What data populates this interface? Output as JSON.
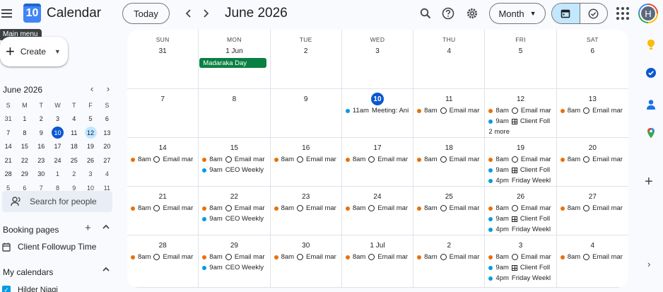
{
  "header": {
    "tooltip": "Main menu",
    "logo_day": "10",
    "app_title": "Calendar",
    "today_label": "Today",
    "prev_icon": "chevron-left-icon",
    "next_icon": "chevron-right-icon",
    "current_period": "June 2026",
    "view_label": "Month",
    "avatar_initial": "H"
  },
  "sidebar": {
    "create_label": "Create",
    "mini_calendar": {
      "title": "June 2026",
      "weekday_heads": [
        "S",
        "M",
        "T",
        "W",
        "T",
        "F",
        "S"
      ],
      "weeks": [
        [
          "31",
          "1",
          "2",
          "3",
          "4",
          "5",
          "6"
        ],
        [
          "7",
          "8",
          "9",
          "10",
          "11",
          "12",
          "13"
        ],
        [
          "14",
          "15",
          "16",
          "17",
          "18",
          "19",
          "20"
        ],
        [
          "21",
          "22",
          "23",
          "24",
          "25",
          "26",
          "27"
        ],
        [
          "28",
          "29",
          "30",
          "1",
          "2",
          "3",
          "4"
        ],
        [
          "5",
          "6",
          "7",
          "8",
          "9",
          "10",
          "11"
        ]
      ],
      "today": "10",
      "selected": "12"
    },
    "search_people_placeholder": "Search for people",
    "booking_pages_title": "Booking pages",
    "booking_item": "Client Followup Time",
    "my_calendars_title": "My calendars",
    "my_calendar_item": "Hilder Njagi"
  },
  "colors": {
    "accent": "#0b57d0",
    "holiday": "#0b8043",
    "orange": "#e8710a",
    "blue": "#039be5"
  },
  "month_grid": {
    "weekday_heads": [
      "SUN",
      "MON",
      "TUE",
      "WED",
      "THU",
      "FRI",
      "SAT"
    ],
    "weeks": [
      [
        {
          "label": "31",
          "events": []
        },
        {
          "label": "1 Jun",
          "allday": "Madaraka Day",
          "events": []
        },
        {
          "label": "2",
          "events": []
        },
        {
          "label": "3",
          "events": []
        },
        {
          "label": "4",
          "events": []
        },
        {
          "label": "5",
          "events": []
        },
        {
          "label": "6",
          "events": []
        }
      ],
      [
        {
          "label": "7",
          "events": []
        },
        {
          "label": "8",
          "events": []
        },
        {
          "label": "9",
          "events": []
        },
        {
          "label": "10",
          "today": true,
          "events": [
            {
              "color": "blue",
              "time": "11am",
              "kind": "none",
              "title": "Meeting: Ani"
            }
          ]
        },
        {
          "label": "11",
          "events": [
            {
              "color": "orange",
              "time": "8am",
              "kind": "task",
              "title": "Email mar"
            }
          ]
        },
        {
          "label": "12",
          "events": [
            {
              "color": "orange",
              "time": "8am",
              "kind": "task",
              "title": "Email mar"
            },
            {
              "color": "blue",
              "time": "9am",
              "kind": "booking",
              "title": "Client Foll"
            }
          ],
          "more": "2 more"
        },
        {
          "label": "13",
          "events": [
            {
              "color": "orange",
              "time": "8am",
              "kind": "task",
              "title": "Email mar"
            }
          ]
        }
      ],
      [
        {
          "label": "14",
          "events": [
            {
              "color": "orange",
              "time": "8am",
              "kind": "task",
              "title": "Email mar"
            }
          ]
        },
        {
          "label": "15",
          "events": [
            {
              "color": "orange",
              "time": "8am",
              "kind": "task",
              "title": "Email mar"
            },
            {
              "color": "blue",
              "time": "9am",
              "kind": "none",
              "title": "CEO Weekly"
            }
          ]
        },
        {
          "label": "16",
          "events": [
            {
              "color": "orange",
              "time": "8am",
              "kind": "task",
              "title": "Email mar"
            }
          ]
        },
        {
          "label": "17",
          "events": [
            {
              "color": "orange",
              "time": "8am",
              "kind": "task",
              "title": "Email mar"
            }
          ]
        },
        {
          "label": "18",
          "events": [
            {
              "color": "orange",
              "time": "8am",
              "kind": "task",
              "title": "Email mar"
            }
          ]
        },
        {
          "label": "19",
          "events": [
            {
              "color": "orange",
              "time": "8am",
              "kind": "task",
              "title": "Email mar"
            },
            {
              "color": "blue",
              "time": "9am",
              "kind": "booking",
              "title": "Client Foll"
            },
            {
              "color": "blue",
              "time": "4pm",
              "kind": "none",
              "title": "Friday Weekl"
            }
          ]
        },
        {
          "label": "20",
          "events": [
            {
              "color": "orange",
              "time": "8am",
              "kind": "task",
              "title": "Email mar"
            }
          ]
        }
      ],
      [
        {
          "label": "21",
          "events": [
            {
              "color": "orange",
              "time": "8am",
              "kind": "task",
              "title": "Email mar"
            }
          ]
        },
        {
          "label": "22",
          "events": [
            {
              "color": "orange",
              "time": "8am",
              "kind": "task",
              "title": "Email mar"
            },
            {
              "color": "blue",
              "time": "9am",
              "kind": "none",
              "title": "CEO Weekly"
            }
          ]
        },
        {
          "label": "23",
          "events": [
            {
              "color": "orange",
              "time": "8am",
              "kind": "task",
              "title": "Email mar"
            }
          ]
        },
        {
          "label": "24",
          "events": [
            {
              "color": "orange",
              "time": "8am",
              "kind": "task",
              "title": "Email mar"
            }
          ]
        },
        {
          "label": "25",
          "events": [
            {
              "color": "orange",
              "time": "8am",
              "kind": "task",
              "title": "Email mar"
            }
          ]
        },
        {
          "label": "26",
          "events": [
            {
              "color": "orange",
              "time": "8am",
              "kind": "task",
              "title": "Email mar"
            },
            {
              "color": "blue",
              "time": "9am",
              "kind": "booking",
              "title": "Client Foll"
            },
            {
              "color": "blue",
              "time": "4pm",
              "kind": "none",
              "title": "Friday Weekl"
            }
          ]
        },
        {
          "label": "27",
          "events": [
            {
              "color": "orange",
              "time": "8am",
              "kind": "task",
              "title": "Email mar"
            }
          ]
        }
      ],
      [
        {
          "label": "28",
          "events": [
            {
              "color": "orange",
              "time": "8am",
              "kind": "task",
              "title": "Email mar"
            }
          ]
        },
        {
          "label": "29",
          "events": [
            {
              "color": "orange",
              "time": "8am",
              "kind": "task",
              "title": "Email mar"
            },
            {
              "color": "blue",
              "time": "9am",
              "kind": "none",
              "title": "CEO Weekly"
            }
          ]
        },
        {
          "label": "30",
          "events": [
            {
              "color": "orange",
              "time": "8am",
              "kind": "task",
              "title": "Email mar"
            }
          ]
        },
        {
          "label": "1 Jul",
          "events": [
            {
              "color": "orange",
              "time": "8am",
              "kind": "task",
              "title": "Email mar"
            }
          ]
        },
        {
          "label": "2",
          "events": [
            {
              "color": "orange",
              "time": "8am",
              "kind": "task",
              "title": "Email mar"
            }
          ]
        },
        {
          "label": "3",
          "events": [
            {
              "color": "orange",
              "time": "8am",
              "kind": "task",
              "title": "Email mar"
            },
            {
              "color": "blue",
              "time": "9am",
              "kind": "booking",
              "title": "Client Foll"
            },
            {
              "color": "blue",
              "time": "4pm",
              "kind": "none",
              "title": "Friday Weekl"
            }
          ]
        },
        {
          "label": "4",
          "events": [
            {
              "color": "orange",
              "time": "8am",
              "kind": "task",
              "title": "Email mar"
            }
          ]
        }
      ]
    ]
  }
}
